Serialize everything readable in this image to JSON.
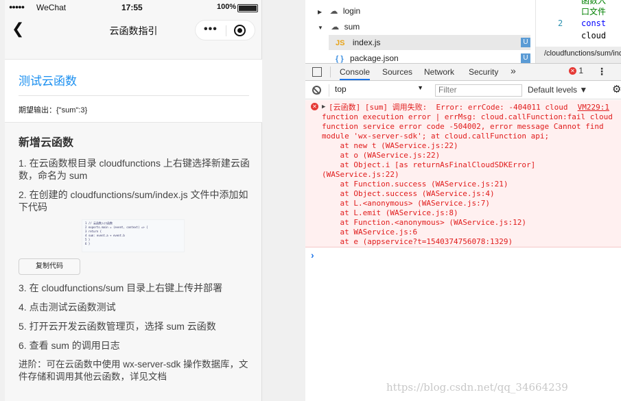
{
  "phone": {
    "status": {
      "carrier": "WeChat",
      "signal": "●●●●●",
      "time": "17:55",
      "battery": "100%"
    },
    "nav": {
      "title": "云函数指引",
      "back_icon": "chevron-left-icon",
      "more_icon": "more-icon",
      "close_icon": "target-icon"
    },
    "card": {
      "link": "测试云函数",
      "expect_label": "期望输出：{\"sum\":3}"
    },
    "guide": {
      "heading": "新增云函数",
      "step1": "1. 在云函数根目录 cloudfunctions 上右键选择新建云函数，命名为 sum",
      "step2": "2. 在创建的 cloudfunctions/sum/index.js 文件中添加如下代码",
      "code_lines": [
        "1  // 云函数入口函数",
        "2  exports.main = (event, context) => {",
        "3    return {",
        "4      sum: event.a + event.b",
        "5    }",
        "6  }"
      ],
      "copy_button": "复制代码",
      "step3": "3. 在 cloudfunctions/sum 目录上右键上传并部署",
      "step4": "4. 点击测试云函数测试",
      "step5": "5. 打开云开发云函数管理页，选择 sum 云函数",
      "step6": "6. 查看 sum 的调用日志",
      "advanced": "进阶：可在云函数中使用 wx-server-sdk 操作数据库，文件存储和调用其他云函数，详见文档"
    }
  },
  "devtools": {
    "tree": [
      {
        "name": "login",
        "kind": "folder",
        "expanded": false
      },
      {
        "name": "sum",
        "kind": "folder",
        "expanded": true
      },
      {
        "name": "index.js",
        "kind": "js",
        "badge": "U",
        "selected": true
      },
      {
        "name": "package.json",
        "kind": "json",
        "badge": "U"
      }
    ],
    "editor": {
      "lines": [
        "函数入",
        "口文件",
        "const",
        "cloud"
      ],
      "line_number": "2"
    },
    "path": "/cloudfunctions/sum/index.js",
    "tabs": [
      "Console",
      "Sources",
      "Network",
      "Security"
    ],
    "active_tab": "Console",
    "overflow": "»",
    "error_count": "1",
    "context": "top",
    "filter_placeholder": "Filter",
    "levels": "Default levels ▼",
    "error": {
      "lines": [
        "[云函数] [sum] 调用失败:  Error: errCode: -404011 cloud",
        "function execution error | errMsg: cloud.callFunction:fail cloud",
        "function service error code -504002, error message Cannot find",
        "module 'wx-server-sdk'; at cloud.callFunction api;",
        "    at new t (WAService.js:22)",
        "    at o (WAService.js:22)",
        "    at Object.i [as returnAsFinalCloudSDKError]",
        "(WAService.js:22)",
        "    at Function.success (WAService.js:21)",
        "    at Object.success (WAService.js:4)",
        "    at L.<anonymous> (WAService.js:7)",
        "    at L.emit (WAService.js:8)",
        "    at Function.<anonymous> (WAService.js:12)",
        "    at WAService.js:6",
        "    at e (appservice?t=1540374756078:1329)"
      ],
      "location": "VM229:1"
    },
    "prompt": "›"
  },
  "watermark": "https://blog.csdn.net/qq_34664239",
  "colors": {
    "accent": "#1a8ff0",
    "error": "#e01b1b",
    "error_bg": "#fff0f0",
    "badge": "#5a9bd5"
  }
}
